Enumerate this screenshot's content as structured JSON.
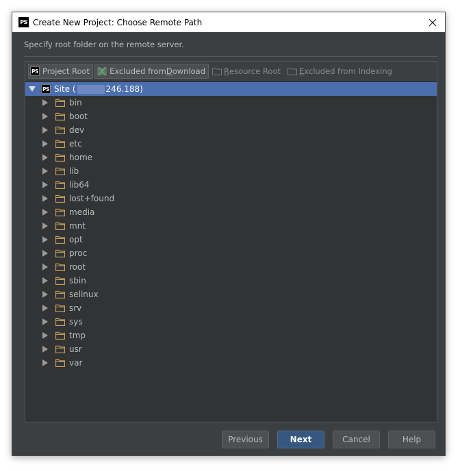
{
  "window": {
    "title": "Create New Project: Choose Remote Path",
    "app_icon": "phpstorm-icon",
    "close_icon": "close-icon"
  },
  "description": "Specify root folder on the remote server.",
  "toolbar": {
    "project_root": {
      "label": "Project Root",
      "pressed": true,
      "icon": "phpstorm-icon"
    },
    "excluded_download": {
      "label_pre": "Excluded from ",
      "label_u": "D",
      "label_post": "ownload",
      "pressed": true,
      "icon": "excluded-x-icon"
    },
    "resource_root": {
      "label_pre": "",
      "label_u": "R",
      "label_post": "esource Root",
      "enabled": false,
      "icon": "folder-icon"
    },
    "excluded_indexing": {
      "label_pre": "",
      "label_u": "E",
      "label_post": "xcluded from Indexing",
      "enabled": false,
      "icon": "folder-icon"
    }
  },
  "tree": {
    "root": {
      "label_prefix": "Site (",
      "label_suffix": "246.188)",
      "expanded": true,
      "selected": true
    },
    "children": [
      "bin",
      "boot",
      "dev",
      "etc",
      "home",
      "lib",
      "lib64",
      "lost+found",
      "media",
      "mnt",
      "opt",
      "proc",
      "root",
      "sbin",
      "selinux",
      "srv",
      "sys",
      "tmp",
      "usr",
      "var"
    ]
  },
  "buttons": {
    "previous": "Previous",
    "next": "Next",
    "cancel": "Cancel",
    "help": "Help"
  },
  "colors": {
    "background": "#3c3f41",
    "tree_background": "#313335",
    "selection": "#4b6eaf",
    "folder": "#c9a05a",
    "default_button": "#365880"
  }
}
